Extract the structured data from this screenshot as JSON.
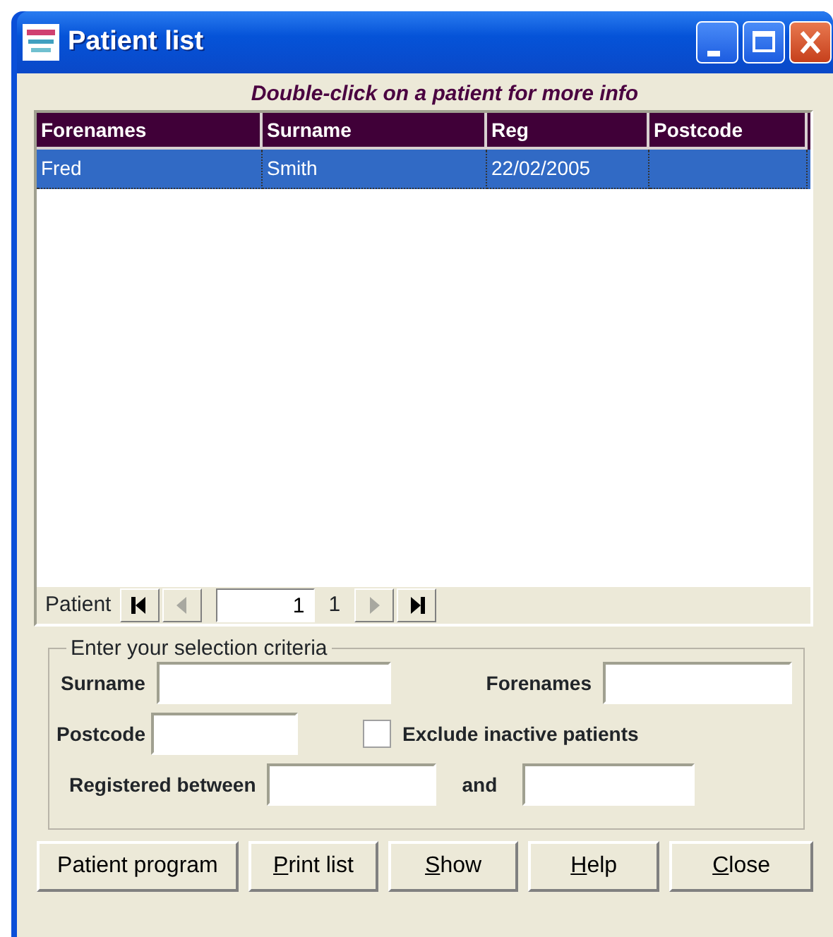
{
  "window": {
    "title": "Patient list"
  },
  "hint": "Double-click on a patient for more info",
  "table": {
    "columns": [
      "Forenames",
      "Surname",
      "Reg",
      "Postcode"
    ],
    "rows": [
      {
        "cells": [
          "Fred",
          "Smith",
          "22/02/2005",
          ""
        ],
        "selected": true
      }
    ]
  },
  "navigator": {
    "label": "Patient",
    "record": "1",
    "count": "1",
    "buttons": [
      {
        "kind": "first",
        "disabled": false
      },
      {
        "kind": "prev",
        "disabled": true
      },
      {
        "kind": "next",
        "disabled": true
      },
      {
        "kind": "last",
        "disabled": false
      }
    ]
  },
  "criteria": {
    "legend": "Enter your selection criteria",
    "surname_label": "Surname",
    "forenames_label": "Forenames",
    "postcode_label": "Postcode",
    "exclude_inactive": {
      "label": "Exclude inactive patients",
      "checked": false
    },
    "registered_label": "Registered between",
    "and_label": "and"
  },
  "buttons": [
    {
      "label": "Patient program",
      "access_key": false
    },
    {
      "label": "Print list",
      "access_key": true
    },
    {
      "label": "Show",
      "access_key": true
    },
    {
      "label": "Help",
      "access_key": true
    },
    {
      "label": "Close",
      "access_key": true
    }
  ]
}
